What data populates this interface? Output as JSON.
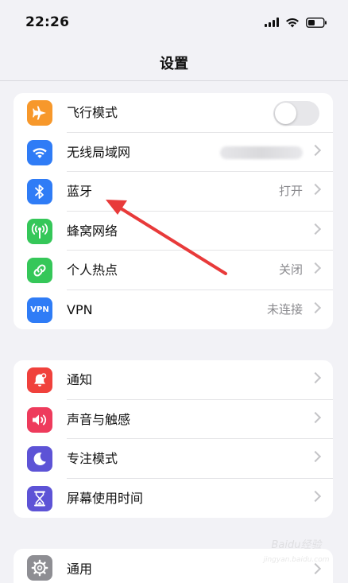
{
  "status_bar": {
    "time": "22:26"
  },
  "nav": {
    "title": "设置"
  },
  "group1": {
    "items": [
      {
        "label": "飞行模式",
        "icon": "airplane-icon",
        "color": "#f7982b",
        "toggle_on": false
      },
      {
        "label": "无线局域网",
        "icon": "wifi-icon",
        "color": "#2f7cf6",
        "value_blurred": true
      },
      {
        "label": "蓝牙",
        "icon": "bluetooth-icon",
        "color": "#2f7cf6",
        "value": "打开"
      },
      {
        "label": "蜂窝网络",
        "icon": "antenna-icon",
        "color": "#35c759"
      },
      {
        "label": "个人热点",
        "icon": "hotspot-link-icon",
        "color": "#35c759",
        "value": "关闭"
      },
      {
        "label": "VPN",
        "icon": "vpn-icon",
        "icon_text": "VPN",
        "color": "#2f7cf6",
        "value": "未连接"
      }
    ]
  },
  "group2": {
    "items": [
      {
        "label": "通知",
        "icon": "notification-bell-icon",
        "color": "#f0413c"
      },
      {
        "label": "声音与触感",
        "icon": "speaker-icon",
        "color": "#ee3b5c"
      },
      {
        "label": "专注模式",
        "icon": "moon-icon",
        "color": "#5d53d6"
      },
      {
        "label": "屏幕使用时间",
        "icon": "hourglass-icon",
        "color": "#5d53d6"
      }
    ]
  },
  "group3": {
    "items": [
      {
        "label": "通用",
        "icon": "gear-icon",
        "color": "#8e8e93"
      }
    ]
  },
  "annotation": {
    "arrow_color": "#e83a3a"
  },
  "watermark": {
    "text_line1": "Baidu经验",
    "text_line2": "jingyan.baidu.com"
  }
}
